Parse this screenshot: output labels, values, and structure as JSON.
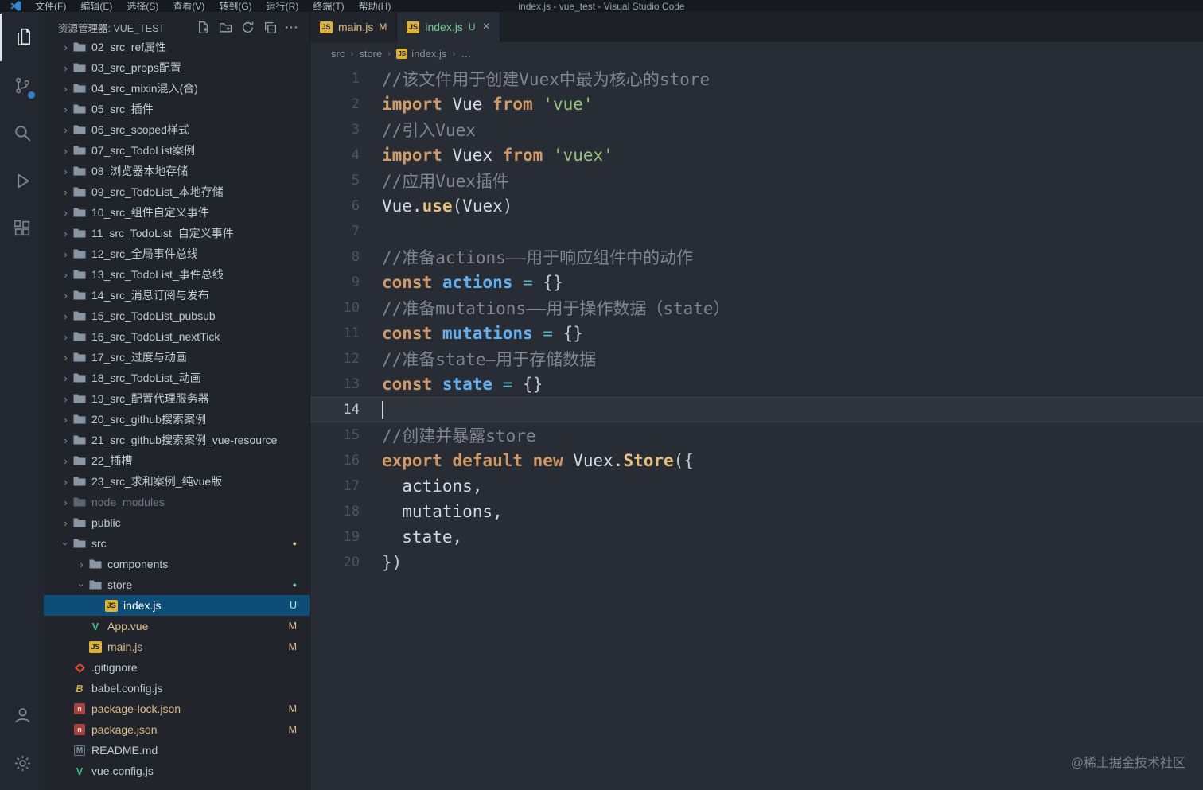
{
  "window": {
    "title": "index.js - vue_test - Visual Studio Code",
    "menus": [
      "文件(F)",
      "编辑(E)",
      "选择(S)",
      "查看(V)",
      "转到(G)",
      "运行(R)",
      "终端(T)",
      "帮助(H)"
    ]
  },
  "activity_bar": {
    "top": [
      {
        "name": "explorer",
        "icon": "files-icon",
        "active": true
      },
      {
        "name": "source-control",
        "icon": "source-control-icon",
        "badge": true
      },
      {
        "name": "search",
        "icon": "search-icon"
      },
      {
        "name": "run-debug",
        "icon": "run-debug-icon"
      },
      {
        "name": "extensions",
        "icon": "extensions-icon"
      }
    ],
    "bottom": [
      {
        "name": "account",
        "icon": "account-icon"
      },
      {
        "name": "settings",
        "icon": "settings-gear-icon"
      }
    ]
  },
  "sidebar": {
    "header_title": "资源管理器: VUE_TEST",
    "actions": [
      {
        "name": "new-file",
        "icon": "new-file-icon"
      },
      {
        "name": "new-folder",
        "icon": "new-folder-icon"
      },
      {
        "name": "refresh",
        "icon": "refresh-icon"
      },
      {
        "name": "collapse-folders",
        "icon": "collapse-all-icon"
      },
      {
        "name": "more-actions",
        "icon": "more-icon"
      }
    ],
    "tree": [
      {
        "label": "02_src_ref属性",
        "type": "folder",
        "level": 0
      },
      {
        "label": "03_src_props配置",
        "type": "folder",
        "level": 0
      },
      {
        "label": "04_src_mixin混入(合)",
        "type": "folder",
        "level": 0
      },
      {
        "label": "05_src_插件",
        "type": "folder",
        "level": 0
      },
      {
        "label": "06_src_scoped样式",
        "type": "folder",
        "level": 0
      },
      {
        "label": "07_src_TodoList案例",
        "type": "folder",
        "level": 0
      },
      {
        "label": "08_浏览器本地存储",
        "type": "folder",
        "level": 0
      },
      {
        "label": "09_src_TodoList_本地存储",
        "type": "folder",
        "level": 0
      },
      {
        "label": "10_src_组件自定义事件",
        "type": "folder",
        "level": 0
      },
      {
        "label": "11_src_TodoList_自定义事件",
        "type": "folder",
        "level": 0
      },
      {
        "label": "12_src_全局事件总线",
        "type": "folder",
        "level": 0
      },
      {
        "label": "13_src_TodoList_事件总线",
        "type": "folder",
        "level": 0
      },
      {
        "label": "14_src_消息订阅与发布",
        "type": "folder",
        "level": 0
      },
      {
        "label": "15_src_TodoList_pubsub",
        "type": "folder",
        "level": 0
      },
      {
        "label": "16_src_TodoList_nextTick",
        "type": "folder",
        "level": 0
      },
      {
        "label": "17_src_过度与动画",
        "type": "folder",
        "level": 0
      },
      {
        "label": "18_src_TodoList_动画",
        "type": "folder",
        "level": 0
      },
      {
        "label": "19_src_配置代理服务器",
        "type": "folder",
        "level": 0
      },
      {
        "label": "20_src_github搜索案例",
        "type": "folder",
        "level": 0
      },
      {
        "label": "21_src_github搜索案例_vue-resource",
        "type": "folder",
        "level": 0
      },
      {
        "label": "22_插槽",
        "type": "folder",
        "level": 0
      },
      {
        "label": "23_src_求和案例_纯vue版",
        "type": "folder",
        "level": 0
      },
      {
        "label": "node_modules",
        "type": "folder",
        "level": 0,
        "dim": true
      },
      {
        "label": "public",
        "type": "folder",
        "level": 0
      },
      {
        "label": "src",
        "type": "folder",
        "level": 0,
        "expanded": true,
        "badge": "dot",
        "badge_color": "modified"
      },
      {
        "label": "components",
        "type": "folder",
        "level": 1
      },
      {
        "label": "store",
        "type": "folder",
        "level": 1,
        "expanded": true,
        "badge": "dot",
        "badge_color": "untracked"
      },
      {
        "label": "index.js",
        "type": "file",
        "icon": "js",
        "level": 2,
        "selected": true,
        "badge": "U"
      },
      {
        "label": "App.vue",
        "type": "file",
        "icon": "vue",
        "level": 1,
        "badge": "M"
      },
      {
        "label": "main.js",
        "type": "file",
        "icon": "js",
        "level": 1,
        "badge": "M"
      },
      {
        "label": ".gitignore",
        "type": "file",
        "icon": "git",
        "level": 0
      },
      {
        "label": "babel.config.js",
        "type": "file",
        "icon": "babel",
        "level": 0
      },
      {
        "label": "package-lock.json",
        "type": "file",
        "icon": "npm",
        "level": 0,
        "badge": "M"
      },
      {
        "label": "package.json",
        "type": "file",
        "icon": "npm",
        "level": 0,
        "badge": "M"
      },
      {
        "label": "README.md",
        "type": "file",
        "icon": "md",
        "level": 0
      },
      {
        "label": "vue.config.js",
        "type": "file",
        "icon": "vue",
        "level": 0
      }
    ]
  },
  "tabs": [
    {
      "label": "main.js",
      "icon": "js",
      "badge": "M",
      "active": false
    },
    {
      "label": "index.js",
      "icon": "js",
      "badge": "U",
      "active": true,
      "close": "×"
    }
  ],
  "breadcrumb": [
    {
      "label": "src"
    },
    {
      "label": "store"
    },
    {
      "label": "index.js",
      "icon": "js"
    },
    {
      "label": "…"
    }
  ],
  "editor": {
    "cursor_line": 14,
    "lines": [
      {
        "n": 1,
        "tokens": [
          {
            "c": "comment",
            "t": "//该文件用于创建Vuex中最为核心的store"
          }
        ]
      },
      {
        "n": 2,
        "tokens": [
          {
            "c": "kw",
            "t": "import"
          },
          {
            "c": "plain",
            "t": " Vue "
          },
          {
            "c": "kw",
            "t": "from"
          },
          {
            "c": "str",
            "t": " 'vue'"
          }
        ]
      },
      {
        "n": 3,
        "tokens": [
          {
            "c": "comment",
            "t": "//引入Vuex"
          }
        ]
      },
      {
        "n": 4,
        "tokens": [
          {
            "c": "kw",
            "t": "import"
          },
          {
            "c": "plain",
            "t": " Vuex "
          },
          {
            "c": "kw",
            "t": "from"
          },
          {
            "c": "str",
            "t": " 'vuex'"
          }
        ]
      },
      {
        "n": 5,
        "tokens": [
          {
            "c": "comment",
            "t": "//应用Vuex插件"
          }
        ]
      },
      {
        "n": 6,
        "tokens": [
          {
            "c": "plain",
            "t": "Vue."
          },
          {
            "c": "fn",
            "t": "use"
          },
          {
            "c": "punct",
            "t": "("
          },
          {
            "c": "plain",
            "t": "Vuex"
          },
          {
            "c": "punct",
            "t": ")"
          }
        ]
      },
      {
        "n": 7,
        "tokens": []
      },
      {
        "n": 8,
        "tokens": [
          {
            "c": "comment",
            "t": "//准备actions——用于响应组件中的动作"
          }
        ]
      },
      {
        "n": 9,
        "tokens": [
          {
            "c": "kw",
            "t": "const"
          },
          {
            "c": "var",
            "t": " actions"
          },
          {
            "c": "op",
            "t": " = "
          },
          {
            "c": "punct",
            "t": "{}"
          }
        ]
      },
      {
        "n": 10,
        "tokens": [
          {
            "c": "comment",
            "t": "//准备mutations——用于操作数据（state）"
          }
        ]
      },
      {
        "n": 11,
        "tokens": [
          {
            "c": "kw",
            "t": "const"
          },
          {
            "c": "var",
            "t": " mutations"
          },
          {
            "c": "op",
            "t": " = "
          },
          {
            "c": "punct",
            "t": "{}"
          }
        ]
      },
      {
        "n": 12,
        "tokens": [
          {
            "c": "comment",
            "t": "//准备state—用于存储数据"
          }
        ]
      },
      {
        "n": 13,
        "tokens": [
          {
            "c": "kw",
            "t": "const"
          },
          {
            "c": "var",
            "t": " state"
          },
          {
            "c": "op",
            "t": " = "
          },
          {
            "c": "punct",
            "t": "{}"
          }
        ]
      },
      {
        "n": 14,
        "tokens": []
      },
      {
        "n": 15,
        "tokens": [
          {
            "c": "comment",
            "t": "//创建并暴露store"
          }
        ]
      },
      {
        "n": 16,
        "tokens": [
          {
            "c": "kw",
            "t": "export"
          },
          {
            "c": "kw",
            "t": " default"
          },
          {
            "c": "kw",
            "t": " new"
          },
          {
            "c": "plain",
            "t": " Vuex."
          },
          {
            "c": "fn",
            "t": "Store"
          },
          {
            "c": "punct",
            "t": "({"
          }
        ]
      },
      {
        "n": 17,
        "tokens": [
          {
            "c": "plain",
            "t": "  actions,"
          }
        ]
      },
      {
        "n": 18,
        "tokens": [
          {
            "c": "plain",
            "t": "  mutations,"
          }
        ]
      },
      {
        "n": 19,
        "tokens": [
          {
            "c": "plain",
            "t": "  state,"
          }
        ]
      },
      {
        "n": 20,
        "tokens": [
          {
            "c": "punct",
            "t": "})"
          }
        ]
      }
    ]
  },
  "watermark": "@稀土掘金技术社区",
  "colors": {
    "accent_blue": "#3b79c7",
    "git_modified": "#e2c08d",
    "git_untracked": "#73c991",
    "selection_blue": "#0f4d79"
  }
}
